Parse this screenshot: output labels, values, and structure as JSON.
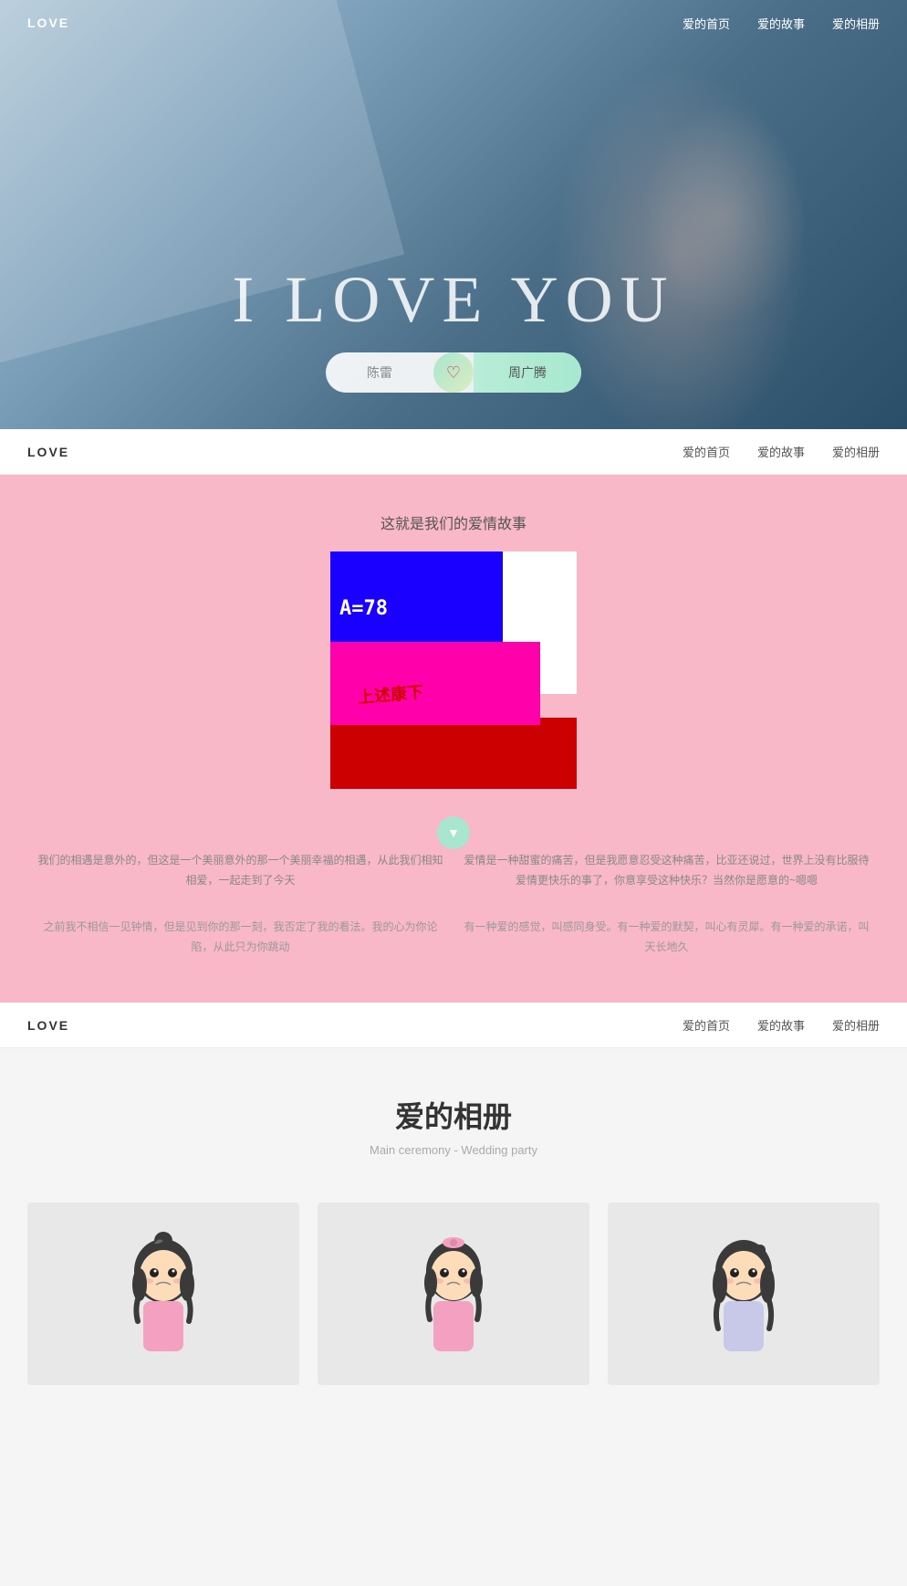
{
  "hero": {
    "title": "I LOVE YOU",
    "logo": "LOVE",
    "name_left": "陈雷",
    "name_right": "周广腾",
    "heart_icon": "♡"
  },
  "nav1": {
    "links": [
      "爱的首页",
      "爱的故事",
      "爱的相册"
    ]
  },
  "nav2": {
    "logo": "LOVE",
    "links": [
      "爱的首页",
      "爱的故事",
      "爱的相册"
    ]
  },
  "nav3": {
    "logo": "LOVE",
    "links": [
      "爱的首页",
      "爱的故事",
      "爱的相册"
    ]
  },
  "story": {
    "section_title": "这就是我们的爱情故事",
    "glitch_text1": "A=78",
    "glitch_text2": "上述康下",
    "text_left": "我们的相遇是意外的，但这是一个美丽意外的那一个美丽幸福的相遇，从此我们相知相爱，一起走到了今天",
    "text_right": "爱情是一种甜蜜的痛苦，但是我愿意忍受这种痛苦，比亚还说过，世界上没有比服待爱情更快乐的事了，你意享受这种快乐？当然你是愿意的~嗯嗯",
    "quote_left": "之前我不相信一见钟情，但是见到你的那一刻，我否定了我的看法。我的心为你论陷，从此只为你跳动",
    "quote_right": "有一种爱的感觉，叫感同身受。有一种爱的默契，叫心有灵犀。有一种爱的承诺，叫天长地久"
  },
  "album": {
    "title": "爱的相册",
    "subtitle": "Main ceremony - Wedding party",
    "photos": [
      {
        "id": 1,
        "alt": "photo1"
      },
      {
        "id": 2,
        "alt": "photo2"
      },
      {
        "id": 3,
        "alt": "photo3"
      }
    ]
  }
}
